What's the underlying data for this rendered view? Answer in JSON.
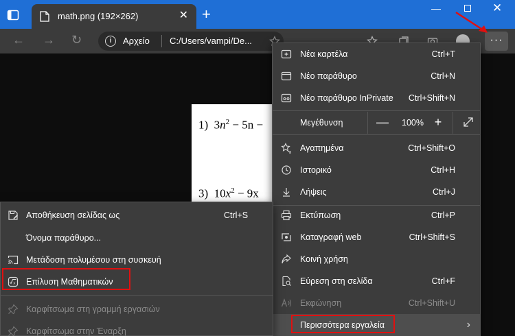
{
  "tab": {
    "title": "math.png (192×262)",
    "close": "✕"
  },
  "newtab_glyph": "+",
  "address": {
    "label": "Αρχείο",
    "url": "C:/Users/vampi/De..."
  },
  "more_glyph": "···",
  "document": {
    "eq1_num": "1)",
    "eq1_a": "3",
    "eq1_n": "n",
    "eq1_sup": "2",
    "eq1_rest": " − 5n −",
    "eq3_num": "3)",
    "eq3_a": "10",
    "eq3_x": "x",
    "eq3_sup": "2",
    "eq3_rest": " − 9x"
  },
  "menu": {
    "new_tab": {
      "label": "Νέα καρτέλα",
      "shortcut": "Ctrl+T"
    },
    "new_window": {
      "label": "Νέο παράθυρο",
      "shortcut": "Ctrl+N"
    },
    "new_private": {
      "label": "Νέο παράθυρο InPrivate",
      "shortcut": "Ctrl+Shift+N"
    },
    "zoom": {
      "label": "Μεγέθυνση",
      "minus": "—",
      "value": "100%",
      "plus": "+"
    },
    "favorites": {
      "label": "Αγαπημένα",
      "shortcut": "Ctrl+Shift+O"
    },
    "history": {
      "label": "Ιστορικό",
      "shortcut": "Ctrl+H"
    },
    "downloads": {
      "label": "Λήψεις",
      "shortcut": "Ctrl+J"
    },
    "print": {
      "label": "Εκτύπωση",
      "shortcut": "Ctrl+P"
    },
    "web_capture": {
      "label": "Καταγραφή web",
      "shortcut": "Ctrl+Shift+S"
    },
    "share": {
      "label": "Κοινή χρήση",
      "shortcut": ""
    },
    "find": {
      "label": "Εύρεση στη σελίδα",
      "shortcut": "Ctrl+F"
    },
    "read_aloud": {
      "label": "Εκφώνηση",
      "shortcut": "Ctrl+Shift+U"
    },
    "more_tools": {
      "label": "Περισσότερα εργαλεία",
      "chevron": "›"
    }
  },
  "submenu": {
    "save_as": {
      "label": "Αποθήκευση σελίδας ως",
      "shortcut": "Ctrl+S"
    },
    "window_name": {
      "label": "Όνομα παράθυρο..."
    },
    "cast": {
      "label": "Μετάδοση πολυμέσου στη συσκευή"
    },
    "math_solver": {
      "label": "Επίλυση Μαθηματικών"
    },
    "pin_taskbar": {
      "label": "Καρφίτσωμα στη γραμμή εργασιών"
    },
    "pin_start": {
      "label": "Καρφίτσωμα στην Έναρξη"
    }
  },
  "colors": {
    "titlebar": "#1f6fd6",
    "menu_bg": "#3c3c3c",
    "highlight": "#e01010"
  }
}
